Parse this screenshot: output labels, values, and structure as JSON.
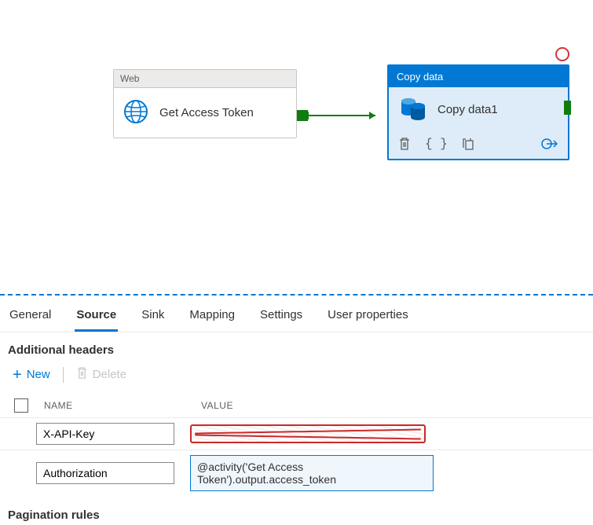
{
  "canvas": {
    "web_node": {
      "header": "Web",
      "label": "Get Access Token"
    },
    "copy_node": {
      "header": "Copy data",
      "label": "Copy data1"
    }
  },
  "tabs": {
    "general": "General",
    "source": "Source",
    "sink": "Sink",
    "mapping": "Mapping",
    "settings": "Settings",
    "user_properties": "User properties"
  },
  "headers_section": {
    "title": "Additional headers",
    "new_btn": "New",
    "delete_btn": "Delete",
    "col_name": "NAME",
    "col_value": "VALUE",
    "rows": [
      {
        "name": "X-API-Key",
        "value": ""
      },
      {
        "name": "Authorization",
        "value": "@activity('Get Access Token').output.access_token"
      }
    ]
  },
  "pagination": {
    "title": "Pagination rules"
  }
}
